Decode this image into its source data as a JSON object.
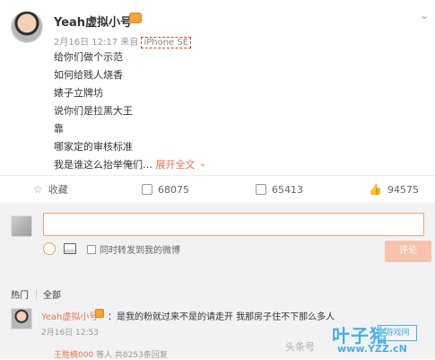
{
  "post": {
    "username": "Yeah虚拟小号",
    "meta_prefix": "2月16日 12:17 来自",
    "device": "iPhone SE",
    "lines": [
      "给你们做个示范",
      "如何给贱人烧香",
      "婊子立牌坊",
      "说你们是拉黑大王",
      "靠",
      "哪家定的审核标准"
    ],
    "last_line_text": "我是谁这么抬举俺们…",
    "expand_label": "展开全文",
    "expand_icon": "chevron-down-icon",
    "more_icon": "chevron-down-icon"
  },
  "actions": {
    "favorite_label": "收藏",
    "share_count": "68075",
    "comment_count": "65413",
    "like_count": "94575"
  },
  "composer": {
    "share_label": "同时转发到我的微博",
    "submit_label": "评论",
    "placeholder": ""
  },
  "filters": {
    "hot": "热门",
    "all": "全部"
  },
  "comment": {
    "username": "Yeah虚拟小号",
    "text": "：是我的粉就过来不是的请走开 我那房子住不下那么多人",
    "time": "2月16日 12:53",
    "reply_user": "王胜楠000",
    "reply_summary": "等人 共8253条回复"
  },
  "watermark": {
    "source": "头条号",
    "brand": "叶子猪",
    "tag": "游戏网",
    "url": "www.YZZ.cN"
  },
  "colors": {
    "accent": "#eb7350",
    "badge": "#f4a43a",
    "button_disabled": "#f7c3ad",
    "watermark": "#2fa6e2"
  }
}
